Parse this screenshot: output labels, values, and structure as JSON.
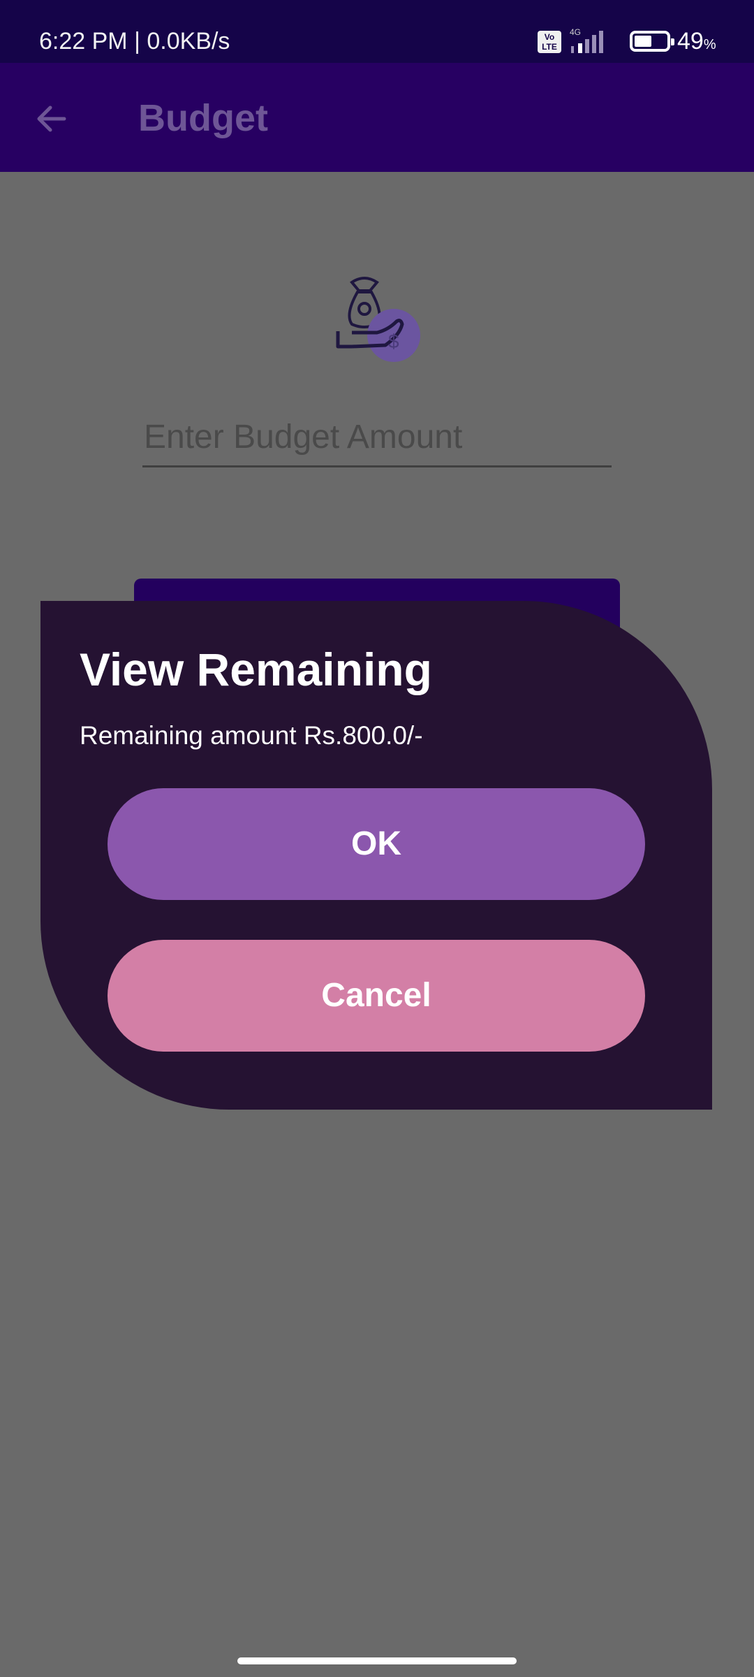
{
  "status_bar": {
    "time_speed": "6:22 PM | 0.0KB/s",
    "volte": "Vo LTE",
    "network": "4G",
    "battery_percent": "49",
    "battery_unit": "%",
    "battery_level": 0.49
  },
  "app_bar": {
    "title": "Budget",
    "back_icon": "arrow-back-icon"
  },
  "page": {
    "icon": "money-bag-hand-icon",
    "budget_input_placeholder": "Enter Budget Amount"
  },
  "dialog": {
    "title": "View Remaining",
    "message": "Remaining amount Rs.800.0/-",
    "ok_label": "OK",
    "cancel_label": "Cancel"
  },
  "colors": {
    "status_bar": "#150449",
    "app_bar": "#270062",
    "scrim": "#6a6a6a",
    "dialog_bg": "#251232",
    "ok_button": "#8b57ad",
    "cancel_button": "#d37fa6"
  }
}
